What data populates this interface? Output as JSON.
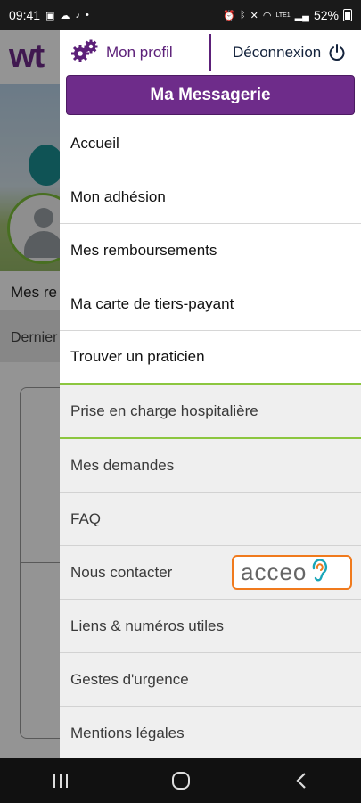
{
  "status_bar": {
    "time": "09:41",
    "battery": "52%",
    "network": "LTE1"
  },
  "background": {
    "logo_text": "wt",
    "section_title": "Mes re",
    "strip_label": "Dernier"
  },
  "drawer": {
    "profile_label": "Mon profil",
    "logout_label": "Déconnexion",
    "messagerie_label": "Ma Messagerie",
    "primary_items": [
      {
        "label": "Accueil"
      },
      {
        "label": "Mon adhésion"
      },
      {
        "label": "Mes remboursements"
      },
      {
        "label": "Ma carte de tiers-payant"
      },
      {
        "label": "Trouver un praticien"
      }
    ],
    "secondary_items": [
      {
        "label": "Prise en charge hospitalière"
      },
      {
        "label": "Mes demandes"
      },
      {
        "label": "FAQ"
      },
      {
        "label": "Nous contacter"
      },
      {
        "label": "Liens & numéros utiles"
      },
      {
        "label": "Gestes d'urgence"
      },
      {
        "label": "Mentions légales"
      }
    ],
    "acceo_label": "acceo"
  },
  "colors": {
    "brand_purple": "#6e2c8a",
    "accent_green": "#8cc63f",
    "acceo_orange": "#f07a1d"
  }
}
